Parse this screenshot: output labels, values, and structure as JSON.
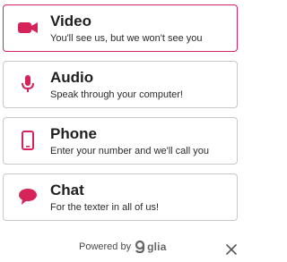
{
  "accent_color": "#d6235a",
  "options": [
    {
      "title": "Video",
      "description": "You'll see us, but we won't see you",
      "icon": "video-camera-icon",
      "selected": true
    },
    {
      "title": "Audio",
      "description": "Speak through your computer!",
      "icon": "microphone-icon",
      "selected": false
    },
    {
      "title": "Phone",
      "description": "Enter your number and we'll call you",
      "icon": "phone-icon",
      "selected": false
    },
    {
      "title": "Chat",
      "description": "For the texter in all of us!",
      "icon": "chat-bubble-icon",
      "selected": false
    }
  ],
  "footer": {
    "powered_by": "Powered by",
    "brand": "glia",
    "close_icon": "close-icon"
  }
}
